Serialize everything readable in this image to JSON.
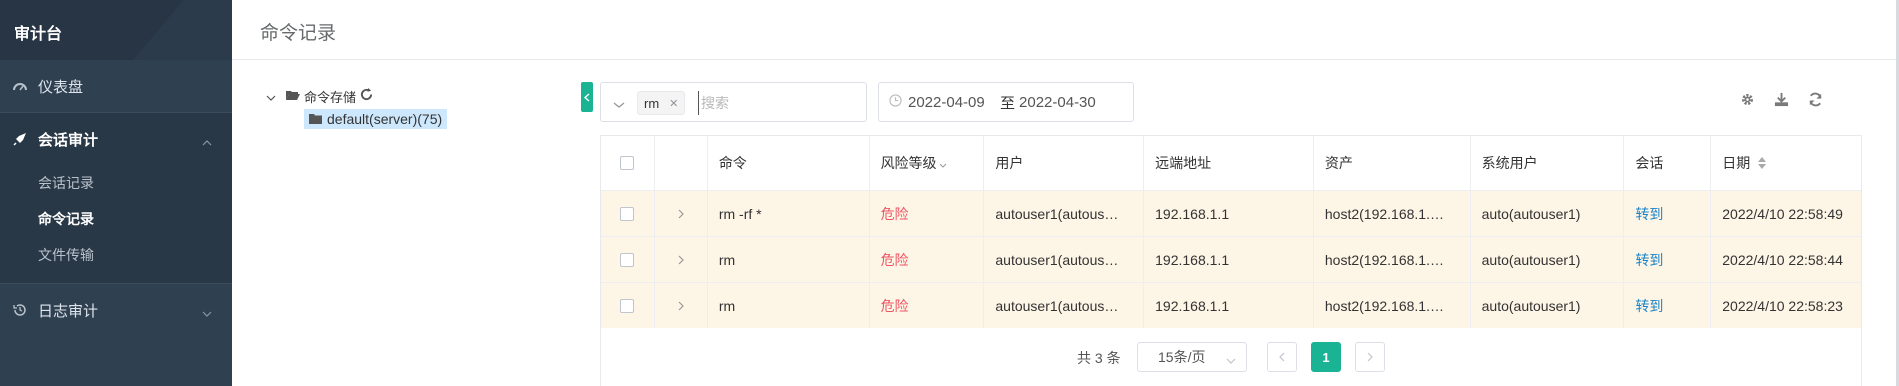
{
  "app": {
    "title": "审计台"
  },
  "sidebar": {
    "items": [
      {
        "label": "仪表盘",
        "icon": "dashboard-icon"
      },
      {
        "label": "会话审计",
        "icon": "rocket-icon"
      },
      {
        "label": "日志审计",
        "icon": "history-icon"
      }
    ],
    "sub_items": [
      {
        "label": "会话记录"
      },
      {
        "label": "命令记录"
      },
      {
        "label": "文件传输"
      }
    ]
  },
  "header": {
    "title": "命令记录"
  },
  "tree": {
    "root_label": "命令存储",
    "child_label": "default(server)(75)"
  },
  "filters": {
    "tag": "rm",
    "search_placeholder": "搜索",
    "date_start": "2022-04-09",
    "date_sep": "至",
    "date_end": "2022-04-30"
  },
  "table": {
    "columns": [
      "命令",
      "风险等级",
      "用户",
      "远端地址",
      "资产",
      "系统用户",
      "会话",
      "日期"
    ],
    "rows": [
      {
        "command": "rm -rf *",
        "risk": "危险",
        "user": "autouser1(autous…",
        "remote": "192.168.1.1",
        "asset": "host2(192.168.1.…",
        "system_user": "auto(autouser1)",
        "session": "转到",
        "date": "2022/4/10 22:58:49"
      },
      {
        "command": "rm",
        "risk": "危险",
        "user": "autouser1(autous…",
        "remote": "192.168.1.1",
        "asset": "host2(192.168.1.…",
        "system_user": "auto(autouser1)",
        "session": "转到",
        "date": "2022/4/10 22:58:44"
      },
      {
        "command": "rm",
        "risk": "危险",
        "user": "autouser1(autous…",
        "remote": "192.168.1.1",
        "asset": "host2(192.168.1.…",
        "system_user": "auto(autouser1)",
        "session": "转到",
        "date": "2022/4/10 22:58:23"
      }
    ]
  },
  "pagination": {
    "total": "共 3 条",
    "page_size": "15条/页",
    "current_page": "1"
  },
  "colors": {
    "sidebar": "#2f4050",
    "accent": "#1ab394",
    "danger": "#ed5565",
    "link": "#1c84c6",
    "row_highlight": "#fdf5e6"
  }
}
